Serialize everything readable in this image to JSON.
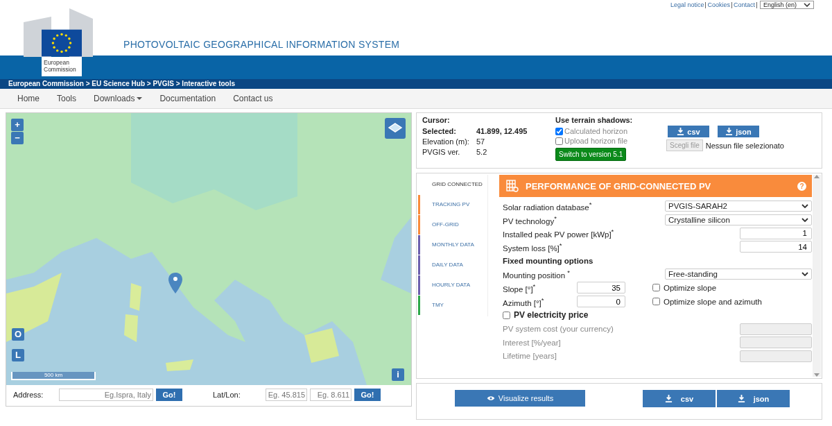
{
  "top_links": [
    {
      "label": "Legal notice"
    },
    {
      "label": "Cookies"
    },
    {
      "label": "Contact"
    }
  ],
  "language": {
    "value": "English (en)"
  },
  "logo": {
    "line1": "European",
    "line2": "Commission"
  },
  "site_title": "PHOTOVOLTAIC GEOGRAPHICAL INFORMATION SYSTEM",
  "breadcrumb": "European Commission > EU Science Hub > PVGIS > Interactive tools",
  "nav": [
    {
      "label": "Home",
      "dropdown": false
    },
    {
      "label": "Tools",
      "dropdown": false
    },
    {
      "label": "Downloads",
      "dropdown": true
    },
    {
      "label": "Documentation",
      "dropdown": false
    },
    {
      "label": "Contact us",
      "dropdown": false
    }
  ],
  "map": {
    "zoom_in": "+",
    "zoom_out": "−",
    "o_button": "O",
    "l_button": "L",
    "scale": "500 km",
    "info": "i"
  },
  "address": {
    "label": "Address:",
    "placeholder": "Eg.Ispra, Italy",
    "go": "Go!"
  },
  "latlon": {
    "label": "Lat/Lon:",
    "lat_placeholder": "Eg. 45.815",
    "lon_placeholder": "Eg. 8.611",
    "go": "Go!"
  },
  "info": {
    "cursor_label": "Cursor:",
    "rows": [
      {
        "label": "Selected:",
        "value": "41.899, 12.495",
        "bold": true
      },
      {
        "label": "Elevation (m):",
        "value": "57",
        "bold": false
      },
      {
        "label": "PVGIS ver.",
        "value": "5.2",
        "bold": false
      }
    ]
  },
  "terrain": {
    "title": "Use terrain shadows:",
    "options": [
      {
        "label": "Calculated horizon",
        "checked": true
      },
      {
        "label": "Upload horizon file",
        "checked": false
      }
    ],
    "switch_button": "Switch to version 5.1"
  },
  "horizon_downloads": [
    {
      "label": "csv"
    },
    {
      "label": "json"
    }
  ],
  "file_picker": {
    "button": "Scegli file",
    "status": "Nessun file selezionato"
  },
  "tabs": [
    {
      "label": "GRID CONNECTED",
      "selected": true,
      "color": "#ffffff"
    },
    {
      "label": "TRACKING PV",
      "selected": false,
      "color": "#f98b3c"
    },
    {
      "label": "OFF-GRID",
      "selected": false,
      "color": "#f98b3c"
    },
    {
      "label": "MONTHLY DATA",
      "selected": false,
      "color": "#6d5fae"
    },
    {
      "label": "DAILY DATA",
      "selected": false,
      "color": "#6d5fae"
    },
    {
      "label": "HOURLY DATA",
      "selected": false,
      "color": "#6d5fae"
    },
    {
      "label": "TMY",
      "selected": false,
      "color": "#2ea84a"
    }
  ],
  "panel_title": "PERFORMANCE OF GRID-CONNECTED PV",
  "help": "?",
  "fields": [
    {
      "kind": "select",
      "label": "Solar radiation database$^{*}$",
      "value": "PVGIS-SARAH2"
    },
    {
      "kind": "select",
      "label": "PV technology$^{*}$",
      "value": "Crystalline silicon"
    },
    {
      "kind": "number",
      "label": "Installed peak PV power [kWp]$^{*}$",
      "value": "1"
    },
    {
      "kind": "number",
      "label": "System loss [%]$^{*}$",
      "value": "14"
    },
    {
      "kind": "heading",
      "label": "Fixed mounting options"
    },
    {
      "kind": "select",
      "label": "Mounting position $^{*}$",
      "value": "Free-standing"
    },
    {
      "kind": "angle",
      "label": "Slope [°]$^{*}$",
      "value": "35",
      "option": "Optimize slope",
      "checked": false
    },
    {
      "kind": "angle",
      "label": "Azimuth [°]$^{*}$",
      "value": "0",
      "option": "Optimize slope and azimuth",
      "checked": false
    },
    {
      "kind": "toggle",
      "label": "PV electricity price",
      "checked": false
    },
    {
      "kind": "disabled",
      "label": "PV system cost (your currency)"
    },
    {
      "kind": "disabled",
      "label": "Interest [%/year]"
    },
    {
      "kind": "disabled",
      "label": "Lifetime [years]"
    }
  ],
  "visualize_button": "Visualize results",
  "result_downloads": [
    {
      "label": "csv"
    },
    {
      "label": "json"
    }
  ]
}
